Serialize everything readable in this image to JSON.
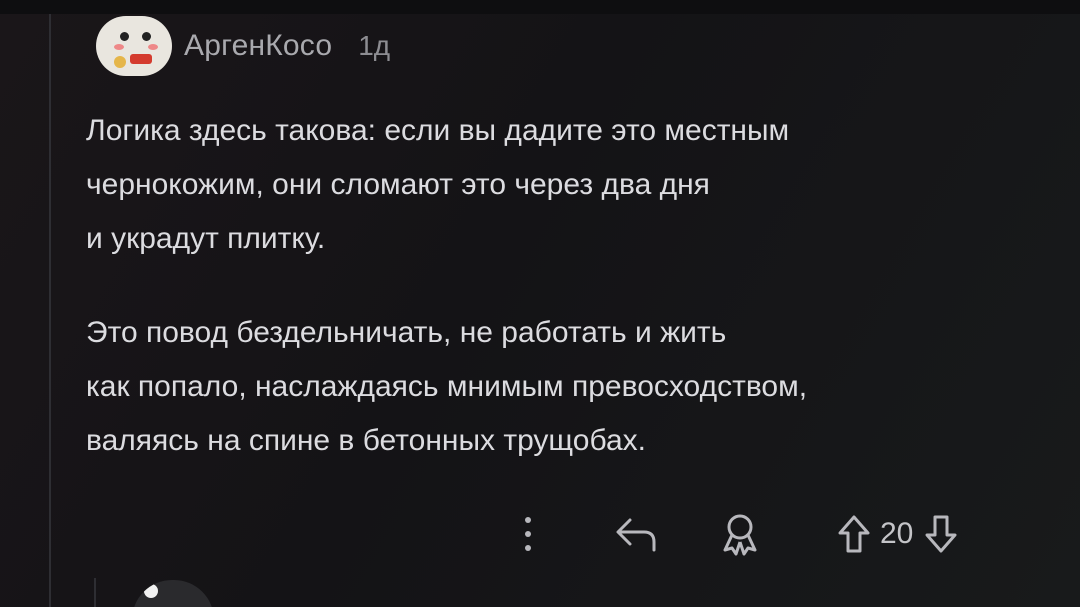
{
  "comment": {
    "author": "АргенКосо",
    "timestamp": "1д",
    "paragraphs": [
      "Логика здесь такова: если вы дадите это местным\nчернокожим, они сломают это через два дня\nи украдут плитку.",
      "Это повод бездельничать, не работать и жить\nкак попало, наслаждаясь мнимым превосходством,\nваляясь на спине в бетонных трущобах."
    ],
    "score": "20"
  },
  "icons": {
    "more": "more-vertical-icon",
    "reply": "reply-icon",
    "award": "award-icon",
    "upvote": "upvote-icon",
    "downvote": "downvote-icon"
  },
  "colors": {
    "background": "#141316",
    "text": "#dcdce0",
    "muted": "#a9a9ae"
  }
}
